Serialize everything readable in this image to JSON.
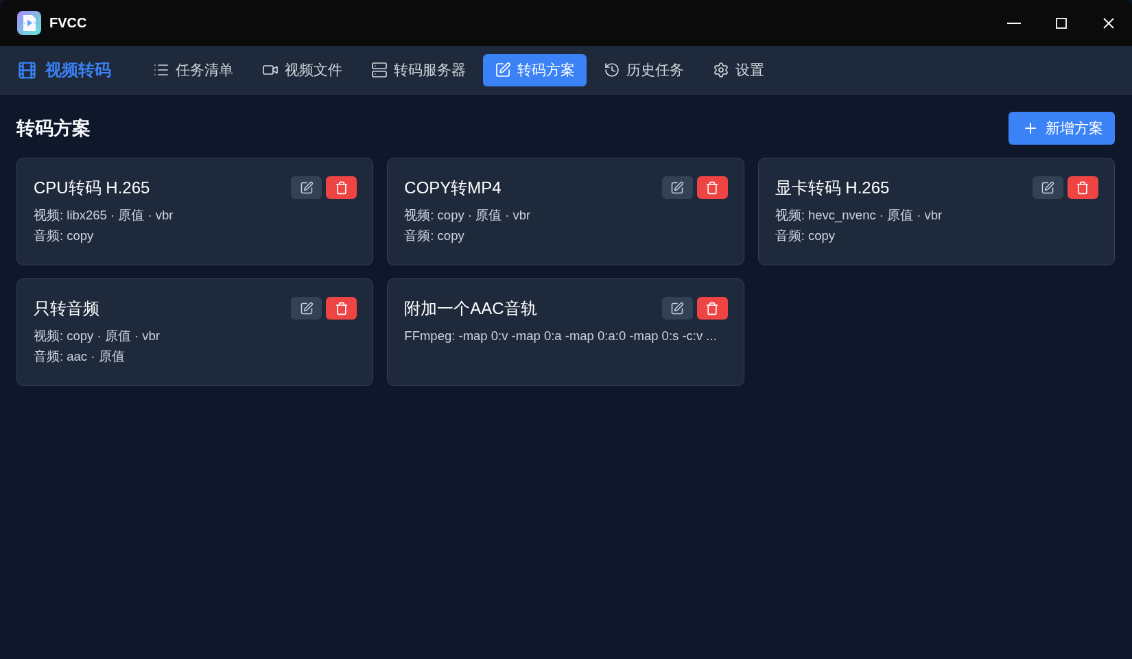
{
  "window": {
    "title": "FVCC"
  },
  "nav": {
    "brand": "视频转码",
    "tabs": [
      {
        "label": "任务清单",
        "selected": false
      },
      {
        "label": "视频文件",
        "selected": false
      },
      {
        "label": "转码服务器",
        "selected": false
      },
      {
        "label": "转码方案",
        "selected": true
      },
      {
        "label": "历史任务",
        "selected": false
      },
      {
        "label": "设置",
        "selected": false
      }
    ]
  },
  "page": {
    "title": "转码方案",
    "add_button": "新增方案"
  },
  "profiles": [
    {
      "title": "CPU转码 H.265",
      "details": [
        "视频: libx265 · 原值 · vbr",
        "音频: copy"
      ]
    },
    {
      "title": "COPY转MP4",
      "details": [
        "视频: copy · 原值 · vbr",
        "音频: copy"
      ]
    },
    {
      "title": "显卡转码 H.265",
      "details": [
        "视频: hevc_nvenc · 原值 · vbr",
        "音频: copy"
      ]
    },
    {
      "title": "只转音频",
      "details": [
        "视频: copy · 原值 · vbr",
        "音频: aac · 原值"
      ]
    },
    {
      "title": "附加一个AAC音轨",
      "details": [
        "FFmpeg: -map 0:v -map 0:a -map 0:a:0 -map 0:s -c:v ..."
      ]
    }
  ]
}
